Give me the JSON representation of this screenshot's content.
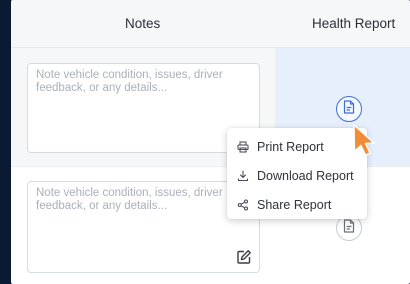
{
  "table": {
    "headers": {
      "notes": "Notes",
      "health_report": "Health Report"
    },
    "rows": [
      {
        "note_placeholder": "Note vehicle condition, issues, driver feedback, or any details...",
        "note_value": ""
      },
      {
        "note_placeholder": "Note vehicle condition, issues, driver feedback, or any details...",
        "note_value": ""
      }
    ]
  },
  "report_menu": {
    "items": [
      {
        "label": "Print Report",
        "icon": "printer-icon"
      },
      {
        "label": "Download Report",
        "icon": "download-icon"
      },
      {
        "label": "Share Report",
        "icon": "share-icon"
      }
    ]
  },
  "colors": {
    "accent": "#3f6fd1",
    "highlight_cell": "#e6f0fd",
    "cursor": "#f28c38"
  }
}
